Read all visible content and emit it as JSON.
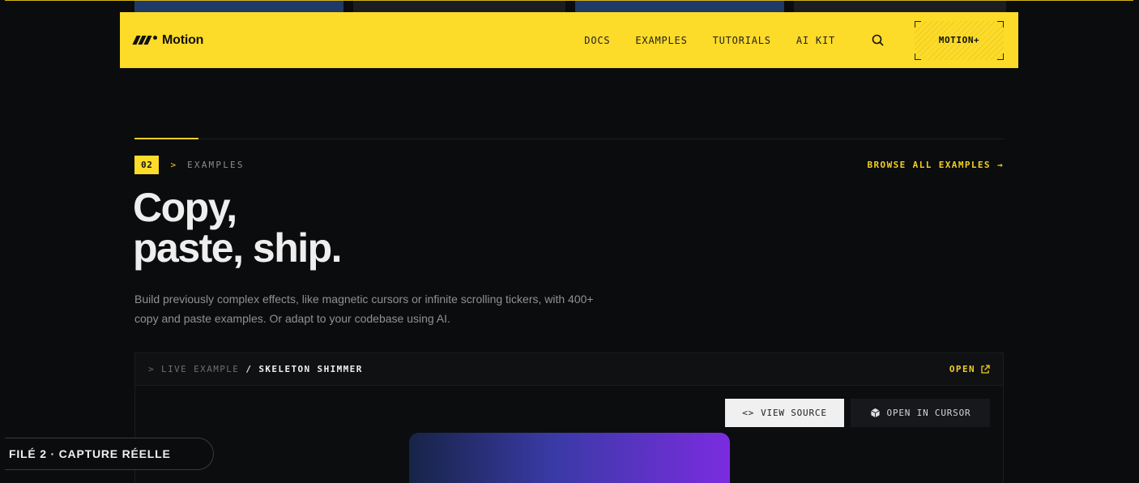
{
  "nav": {
    "logo_text": "Motion",
    "links": [
      "DOCS",
      "EXAMPLES",
      "TUTORIALS",
      "AI KIT"
    ],
    "cta_label": "MOTION+"
  },
  "section": {
    "number": "02",
    "arrow": ">",
    "label": "EXAMPLES",
    "browse_label": "BROWSE ALL EXAMPLES →",
    "title_line1": "Copy,",
    "title_line2": "paste, ship.",
    "description": "Build previously complex effects, like magnetic cursors or infinite scrolling tickers, with 400+ copy and paste examples. Or adapt to your codebase using AI."
  },
  "demo": {
    "crumb_prefix": "> LIVE EXAMPLE",
    "crumb_sep": "/",
    "crumb_name": "SKELETON SHIMMER",
    "open_label": "OPEN",
    "view_source_label": "VIEW SOURCE",
    "open_cursor_label": "OPEN IN CURSOR"
  },
  "caption": "FILÉ 2 · CAPTURE RÉELLE",
  "colors": {
    "accent": "#fddb29",
    "background": "#0b0c0d"
  }
}
